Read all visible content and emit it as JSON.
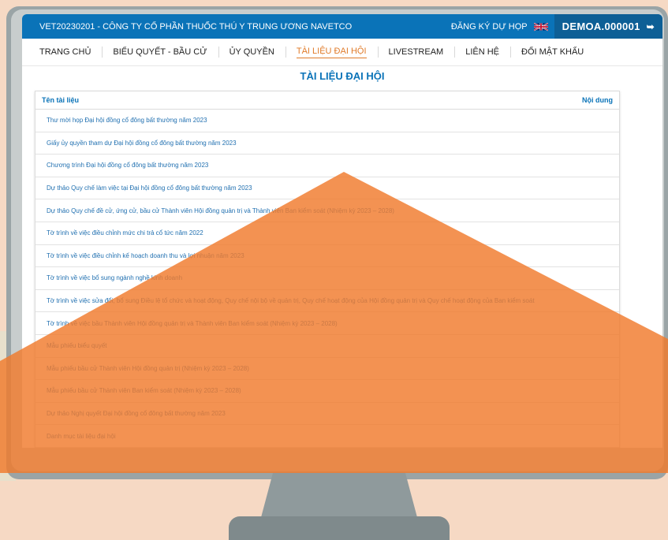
{
  "header": {
    "company": "VET20230201 - CÔNG TY CỔ PHẦN THUỐC THÚ Y TRUNG ƯƠNG NAVETCO",
    "register": "ĐĂNG KÝ DỰ HỌP",
    "account": "DEMOA.000001",
    "flag_icon": "uk-flag-icon",
    "logout_icon": "logout-icon"
  },
  "nav": {
    "items": [
      {
        "label": "TRANG CHỦ"
      },
      {
        "label": "BIỂU QUYẾT - BẦU CỬ"
      },
      {
        "label": "ỦY QUYỀN"
      },
      {
        "label": "TÀI LIỆU ĐẠI HỘI"
      },
      {
        "label": "LIVESTREAM"
      },
      {
        "label": "LIÊN HỆ"
      },
      {
        "label": "ĐỔI MẬT KHẨU"
      }
    ],
    "active_index": 3
  },
  "page": {
    "title": "TÀI LIỆU ĐẠI HỘI"
  },
  "table": {
    "col_name": "Tên tài liệu",
    "col_content": "Nội dung",
    "rows": [
      "Thư mời họp Đại hội đồng cổ đông bất thường năm 2023",
      "Giấy ủy quyền tham dự Đại hội đồng cổ đông bất thường năm 2023",
      "Chương trình Đại hội đồng cổ đông bất thường năm 2023",
      "Dự thảo Quy chế làm việc tại Đại hội đồng cổ đông bất thường năm 2023",
      "Dự thảo Quy chế đề cử, ứng cử, bầu cử Thành viên Hội đồng quản trị và Thành viên Ban kiểm soát (Nhiệm kỳ 2023 – 2028)",
      "Tờ trình về việc điều chỉnh mức chi trả cổ tức năm 2022",
      "Tờ trình về việc điều chỉnh kế hoạch doanh thu và lợi nhuận năm 2023",
      "Tờ trình về việc bổ sung ngành nghề kinh doanh",
      "Tờ trình về việc sửa đổi, bổ sung Điều lệ tổ chức và hoạt động, Quy chế nội bộ về quản trị, Quy chế hoạt động của Hội đồng quản trị và Quy chế hoạt động của Ban kiểm soát",
      "Tờ trình về việc bầu Thành viên Hội đồng quản trị và Thành viên Ban kiểm soát (Nhiệm kỳ 2023 – 2028)",
      "Mẫu phiếu biểu quyết",
      "Mẫu phiếu bầu cử Thành viên Hội đồng quản trị (Nhiệm kỳ 2023 – 2028)",
      "Mẫu phiếu bầu cử Thành viên Ban kiểm soát (Nhiệm kỳ 2023 – 2028)",
      "Dự thảo Nghị quyết Đại hội đồng cổ đông bất thường năm 2023",
      "Danh mục tài liệu đại hội"
    ]
  },
  "colors": {
    "primary": "#0a73b8",
    "accent": "#e07b2a",
    "overlay": "#f07a2c"
  }
}
